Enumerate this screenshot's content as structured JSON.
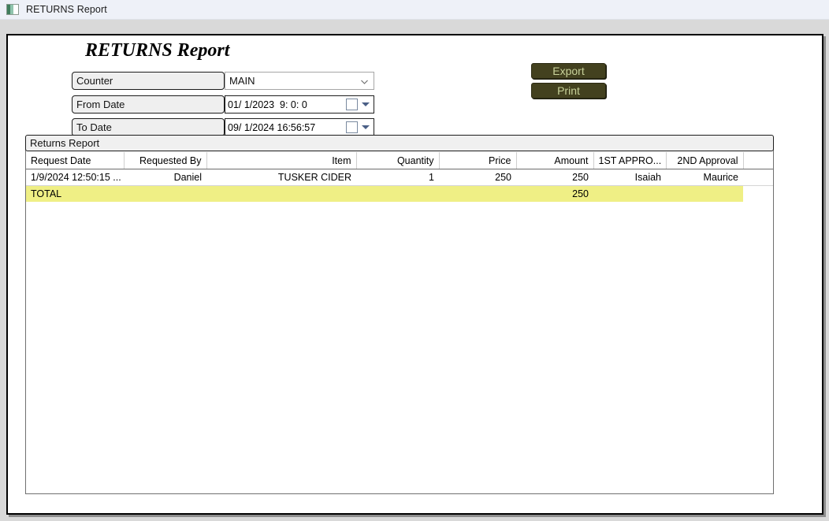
{
  "window": {
    "title": "RETURNS Report",
    "icon": "application-icon"
  },
  "report": {
    "heading": "RETURNS Report"
  },
  "filters": {
    "counter": {
      "label": "Counter",
      "value": "MAIN",
      "caret_icon": "chevron-down-icon"
    },
    "from_date": {
      "label": "From Date",
      "value": "01/ 1/2023  9: 0: 0",
      "calendar_icon": "calendar-icon",
      "spinner_icon": "dropdown-triangle-icon"
    },
    "to_date": {
      "label": "To Date",
      "value": "09/ 1/2024 16:56:57",
      "calendar_icon": "calendar-icon",
      "spinner_icon": "dropdown-triangle-icon"
    }
  },
  "actions": {
    "export_label": "Export",
    "print_label": "Print"
  },
  "grid": {
    "group_title": "Returns Report",
    "columns": [
      {
        "label": "Request Date",
        "align": "al-left"
      },
      {
        "label": "Requested By",
        "align": "al-right"
      },
      {
        "label": "Item",
        "align": "al-right"
      },
      {
        "label": "Quantity",
        "align": "al-right"
      },
      {
        "label": "Price",
        "align": "al-right"
      },
      {
        "label": "Amount",
        "align": "al-right"
      },
      {
        "label": "1ST APPRO...",
        "align": "al-right"
      },
      {
        "label": "2ND Approval",
        "align": "al-right"
      },
      {
        "label": "",
        "align": "al-left"
      }
    ],
    "rows": [
      {
        "request_date": "1/9/2024 12:50:15 ...",
        "requested_by": "Daniel",
        "item": "TUSKER CIDER",
        "quantity": "1",
        "price": "250",
        "amount": "250",
        "first_approval": "Isaiah",
        "second_approval": "Maurice",
        "tail": ""
      }
    ],
    "total_row": {
      "request_date": "TOTAL",
      "requested_by": "",
      "item": "",
      "quantity": "",
      "price": "",
      "amount": "250",
      "first_approval": "",
      "second_approval": "",
      "tail": ""
    }
  },
  "colors": {
    "button_bg": "#43411f",
    "button_text": "#c8d29a",
    "total_row_bg": "#efef85",
    "titlebar_bg": "#eef1f8",
    "desktop_bg": "#d9d9d9"
  }
}
